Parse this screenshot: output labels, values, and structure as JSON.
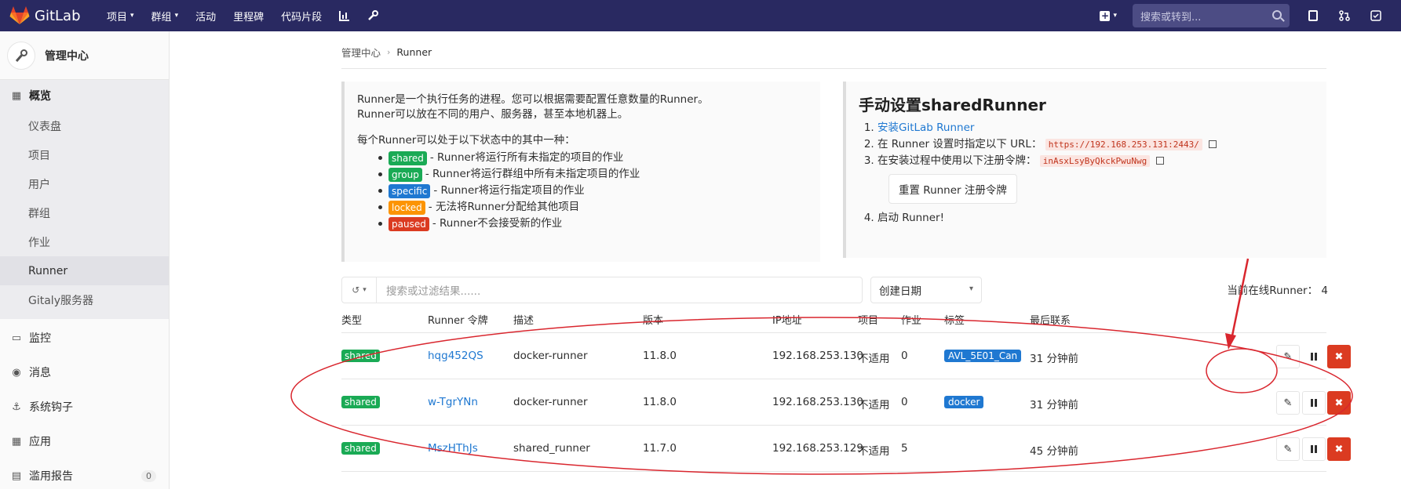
{
  "topbar": {
    "brand": "GitLab",
    "nav": [
      {
        "label": "项目",
        "dropdown": true
      },
      {
        "label": "群组",
        "dropdown": true
      },
      {
        "label": "活动",
        "dropdown": false
      },
      {
        "label": "里程碑",
        "dropdown": false
      },
      {
        "label": "代码片段",
        "dropdown": false
      }
    ],
    "search_placeholder": "搜索或转到..."
  },
  "sidebar": {
    "title": "管理中心",
    "overview": "概览",
    "subitems": [
      "仪表盘",
      "项目",
      "用户",
      "群组",
      "作业",
      "Runner",
      "Gitaly服务器"
    ],
    "sections": [
      "监控",
      "消息",
      "系统钩子",
      "应用",
      "滥用报告"
    ],
    "abuse_count": "0"
  },
  "breadcrumb": {
    "root": "管理中心",
    "current": "Runner"
  },
  "info_left": {
    "line1": "Runner是一个执行任务的进程。您可以根据需要配置任意数量的Runner。",
    "line2": "Runner可以放在不同的用户、服务器，甚至本地机器上。",
    "intro": "每个Runner可以处于以下状态中的其中一种：",
    "states": [
      {
        "badge": "shared",
        "text": "- Runner将运行所有未指定的项目的作业",
        "color": "#1aaa55"
      },
      {
        "badge": "group",
        "text": "- Runner将运行群组中所有未指定项目的作业",
        "color": "#1aaa55"
      },
      {
        "badge": "specific",
        "text": "- Runner将运行指定项目的作业",
        "color": "#1f78d1"
      },
      {
        "badge": "locked",
        "text": "- 无法将Runner分配给其他项目",
        "color": "#fc9403"
      },
      {
        "badge": "paused",
        "text": "- Runner不会接受新的作业",
        "color": "#db3b21"
      }
    ]
  },
  "info_right": {
    "title": "手动设置sharedRunner",
    "step1_link": "安装GitLab Runner",
    "step2_text": "在 Runner 设置时指定以下 URL：",
    "url": "https://192.168.253.131:2443/",
    "step3_text": "在安装过程中使用以下注册令牌：",
    "token": "inAsxLsyByQkckPwuNwg",
    "reset_button": "重置 Runner 注册令牌",
    "step4_text": "启动 Runner!"
  },
  "filter": {
    "placeholder": "搜索或过滤结果......",
    "sort_label": "创建日期"
  },
  "online_count": "当前在线Runner：  4",
  "table": {
    "headers": [
      "类型",
      "Runner 令牌",
      "描述",
      "版本",
      "IP地址",
      "项目",
      "作业",
      "标签",
      "最后联系"
    ],
    "rows": [
      {
        "type": "shared",
        "token": "hqg452QS",
        "description": "docker-runner",
        "version": "11.8.0",
        "ip": "192.168.253.130",
        "projects": "不适用",
        "jobs": "0",
        "tag": "AVL_5E01_Can",
        "last_contact": "31 分钟前"
      },
      {
        "type": "shared",
        "token": "w-TgrYNn",
        "description": "docker-runner",
        "version": "11.8.0",
        "ip": "192.168.253.130",
        "projects": "不适用",
        "jobs": "0",
        "tag": "docker",
        "last_contact": "31 分钟前"
      },
      {
        "type": "shared",
        "token": "MszHThJs",
        "description": "shared_runner",
        "version": "11.7.0",
        "ip": "192.168.253.129",
        "projects": "不适用",
        "jobs": "5",
        "tag": "",
        "last_contact": "45 分钟前"
      }
    ]
  },
  "colors": {
    "topbar": "#292961",
    "shared": "#1aaa55",
    "link": "#1f78d1",
    "danger": "#db3b21",
    "annotation": "#d9262e"
  }
}
